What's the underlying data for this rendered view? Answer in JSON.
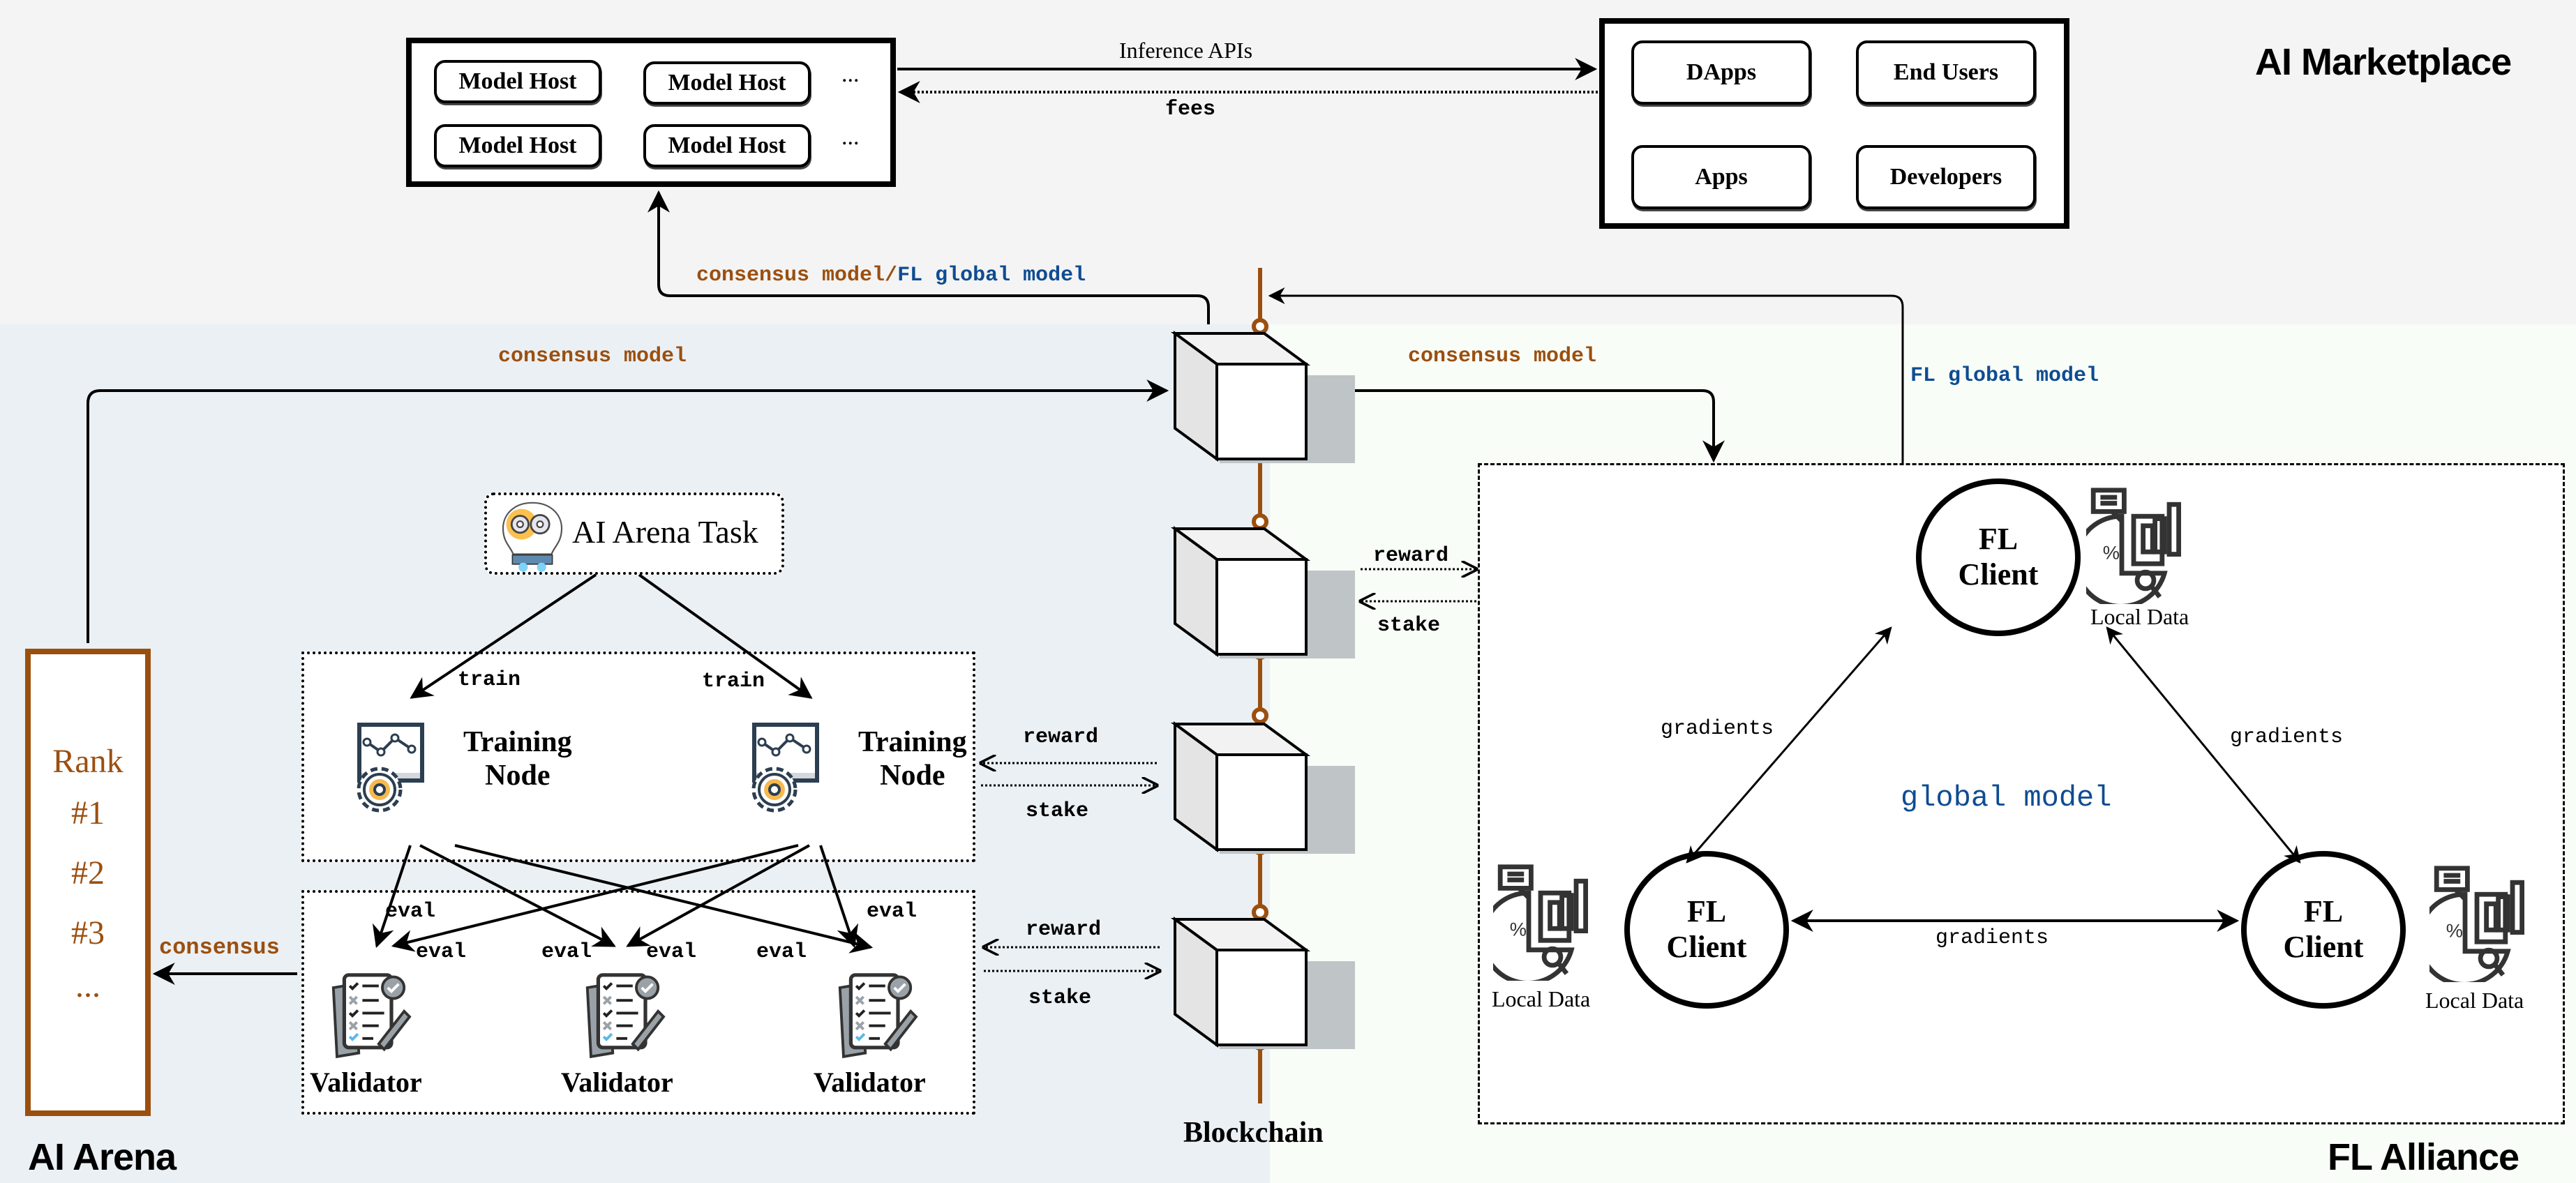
{
  "regions": {
    "marketplace": "AI Marketplace",
    "arena": "AI Arena",
    "fl_alliance": "FL Alliance"
  },
  "colors": {
    "marketplace_bg": "#f4f4f4",
    "arena_bg": "#ebf0f4",
    "fl_bg": "#f9fdf8",
    "consensus_brown": "#9b4f0f",
    "fl_blue": "#0e4c92",
    "chain_brown": "#9b4f0f"
  },
  "marketplace": {
    "model_hosts": [
      "Model Host",
      "Model Host",
      "Model Host",
      "Model Host"
    ],
    "ellipsis": [
      "...",
      "..."
    ],
    "consumers": [
      "DApps",
      "End Users",
      "Apps",
      "Developers"
    ],
    "inference_label": "Inference APIs",
    "fees_label": "fees"
  },
  "edges": {
    "consensus_or_fl_prefix": "consensus model",
    "slash": "/",
    "consensus_or_fl_suffix": "FL global model",
    "consensus_model_left": "consensus model",
    "consensus_model_right": "consensus model",
    "fl_global_model": "FL global model",
    "reward": "reward",
    "stake": "stake",
    "train": "train",
    "eval": "eval",
    "consensus": "consensus",
    "gradients": "gradients"
  },
  "arena": {
    "task_label": "AI Arena Task",
    "training_nodes": [
      {
        "line1": "Training",
        "line2": "Node"
      },
      {
        "line1": "Training",
        "line2": "Node"
      }
    ],
    "validators": [
      "Validator",
      "Validator",
      "Validator"
    ],
    "rank": {
      "title": "Rank",
      "items": [
        "#1",
        "#2",
        "#3",
        "..."
      ]
    }
  },
  "blockchain": {
    "label": "Blockchain",
    "block_count": 4
  },
  "fl": {
    "clients": [
      {
        "line1": "FL",
        "line2": "Client"
      },
      {
        "line1": "FL",
        "line2": "Client"
      },
      {
        "line1": "FL",
        "line2": "Client"
      }
    ],
    "local_data_label": "Local Data",
    "center_label": "global model"
  }
}
